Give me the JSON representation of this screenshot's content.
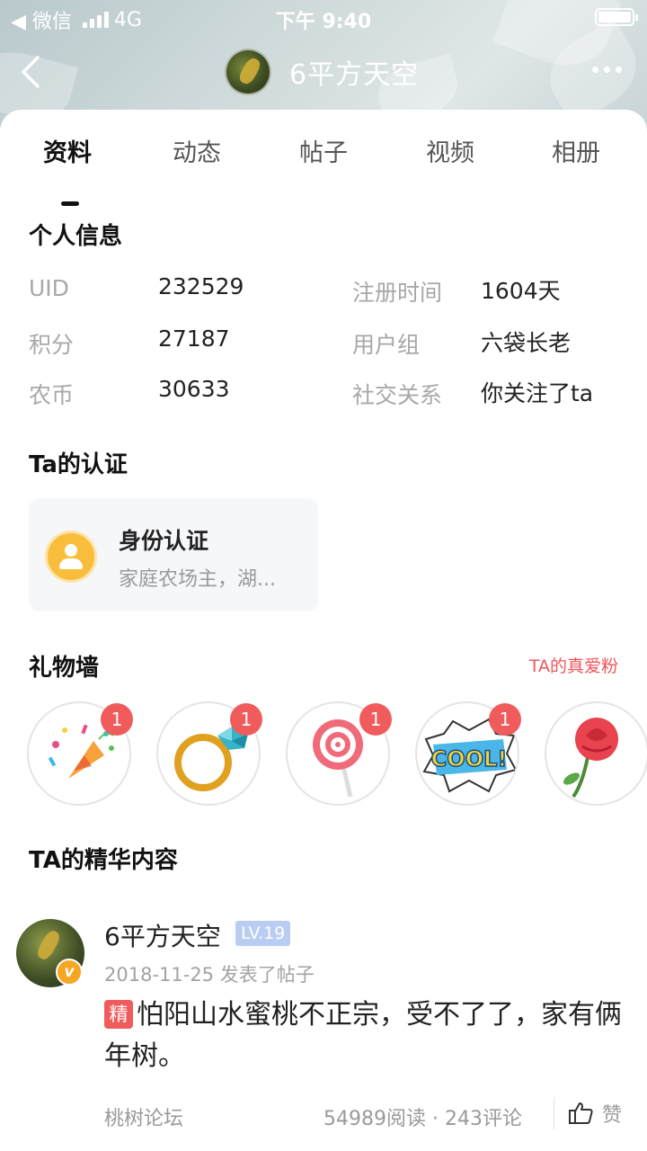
{
  "status_bar": {
    "back_app": "◀ 微信",
    "network": "4G",
    "time": "下午 9:40"
  },
  "nav": {
    "title": "6平方天空"
  },
  "tabs": [
    {
      "label": "资料",
      "active": true
    },
    {
      "label": "动态",
      "active": false
    },
    {
      "label": "帖子",
      "active": false
    },
    {
      "label": "视频",
      "active": false
    },
    {
      "label": "相册",
      "active": false
    }
  ],
  "personal_info": {
    "title": "个人信息",
    "rows": [
      {
        "label": "UID",
        "value": "232529"
      },
      {
        "label": "积分",
        "value": "27187"
      },
      {
        "label": "农币",
        "value": "30633"
      },
      {
        "label": "注册时间",
        "value": "1604天"
      },
      {
        "label": "用户组",
        "value": "六袋长老"
      },
      {
        "label": "社交关系",
        "value": "你关注了ta"
      }
    ]
  },
  "certification": {
    "title": "Ta的认证",
    "card_title": "身份认证",
    "card_desc": "家庭农场主，湖..."
  },
  "gift_wall": {
    "title": "礼物墙",
    "fan_link": "TA的真爱粉",
    "gifts": [
      {
        "icon": "party-popper-icon",
        "count": "1"
      },
      {
        "icon": "diamond-ring-icon",
        "count": "1"
      },
      {
        "icon": "lollipop-icon",
        "count": "1"
      },
      {
        "icon": "cool-sticker-icon",
        "count": "1"
      },
      {
        "icon": "rose-icon",
        "count": ""
      }
    ]
  },
  "featured": {
    "title": "TA的精华内容",
    "post": {
      "author": "6平方天空",
      "level": "LV.19",
      "verified_mark": "v",
      "meta": "2018-11-25 发表了帖子",
      "tag": "精",
      "content": "怕阳山水蜜桃不正宗，受不了了，家有俩年树。",
      "forum": "桃树论坛",
      "stats": "54989阅读 · 243评论",
      "like_label": "赞"
    }
  },
  "colors": {
    "accent_red": "#f05c5c",
    "level_badge": "#b9cdf3",
    "cert_icon": "#f9bd3c",
    "verified_badge": "#f5a623"
  }
}
